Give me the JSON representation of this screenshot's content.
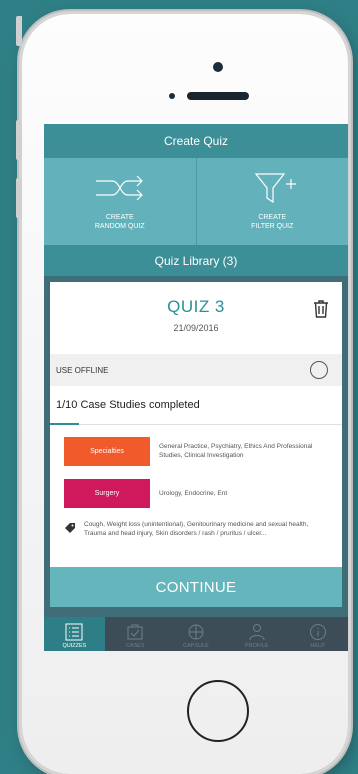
{
  "colors": {
    "background": "#2f7f86",
    "header_bar": "#3c8e97",
    "create_tiles": "#63b2bb",
    "accent": "#2b8f98",
    "continue_button": "#65b5bd",
    "tabbar": "#3d4d58",
    "tag_specialties": "#f15a2b",
    "tag_surgery": "#d0185c"
  },
  "create_quiz": {
    "title": "Create Quiz",
    "random": {
      "line1": "CREATE",
      "line2": "RANDOM QUIZ",
      "icon": "shuffle-icon"
    },
    "filter": {
      "line1": "CREATE",
      "line2": "FILTER QUIZ",
      "icon": "filter-plus-icon"
    }
  },
  "library": {
    "title": "Quiz Library (3)",
    "quiz": {
      "name": "QUIZ 3",
      "date": "21/09/2016",
      "offline_label": "USE OFFLINE",
      "progress_text": "1/10 Case Studies completed",
      "progress_fraction": 0.1,
      "tags": [
        {
          "label": "Specialties",
          "text": "General Practice, Psychiatry, Ethics And Professional Studies, Clinical Investigation"
        },
        {
          "label": "Surgery",
          "text": "Urology, Endocrine, Ent"
        }
      ],
      "keywords": "Cough, Weight loss (unintentional), Genitourinary medicine and sexual health, Trauma and head injury, Skin disorders / rash / pruritus / ulcer...",
      "continue_label": "CONTINUE"
    }
  },
  "tabs": [
    {
      "label": "QUIZZES",
      "icon": "list-icon",
      "active": true
    },
    {
      "label": "CASES",
      "icon": "cases-icon",
      "active": false
    },
    {
      "label": "CAPSULE",
      "icon": "capsule-icon",
      "active": false
    },
    {
      "label": "PROFILE",
      "icon": "profile-icon",
      "active": false
    },
    {
      "label": "HELP",
      "icon": "help-icon",
      "active": false
    }
  ]
}
